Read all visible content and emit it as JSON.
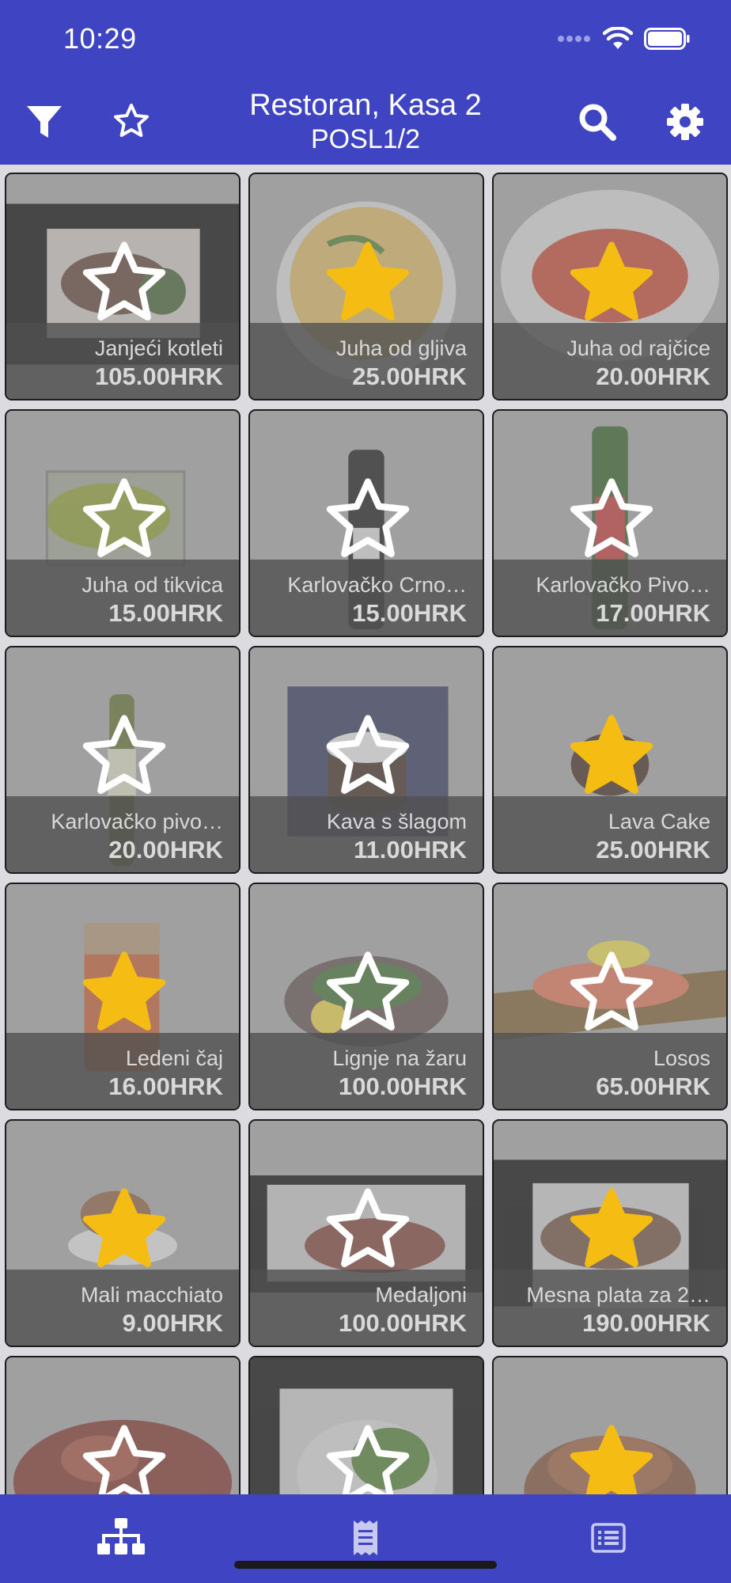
{
  "status_bar": {
    "time": "10:29"
  },
  "header": {
    "title": "Restoran, Kasa 2",
    "subtitle": "POSL1/2"
  },
  "colors": {
    "bar": "#3f44c2",
    "star_filled": "#f5bd14",
    "star_outline": "#ffffff"
  },
  "icons": {
    "filter": "filter-icon",
    "favorites": "star-icon",
    "search": "search-icon",
    "settings": "gear-icon",
    "categories": "hierarchy-icon",
    "receipt": "receipt-icon",
    "list": "list-icon"
  },
  "products": [
    {
      "name": "Janjeći kotleti",
      "price": "105.00HRK",
      "favorite": false
    },
    {
      "name": "Juha od gljiva",
      "price": "25.00HRK",
      "favorite": true
    },
    {
      "name": "Juha od rajčice",
      "price": "20.00HRK",
      "favorite": true
    },
    {
      "name": "Juha od tikvica",
      "price": "15.00HRK",
      "favorite": false
    },
    {
      "name": "Karlovačko Crno…",
      "price": "15.00HRK",
      "favorite": false
    },
    {
      "name": "Karlovačko Pivo…",
      "price": "17.00HRK",
      "favorite": false
    },
    {
      "name": "Karlovačko pivo…",
      "price": "20.00HRK",
      "favorite": false
    },
    {
      "name": "Kava s šlagom",
      "price": "11.00HRK",
      "favorite": false
    },
    {
      "name": "Lava Cake",
      "price": "25.00HRK",
      "favorite": true
    },
    {
      "name": "Ledeni čaj",
      "price": "16.00HRK",
      "favorite": true
    },
    {
      "name": "Lignje na žaru",
      "price": "100.00HRK",
      "favorite": false
    },
    {
      "name": "Losos",
      "price": "65.00HRK",
      "favorite": false
    },
    {
      "name": "Mali macchiato",
      "price": "9.00HRK",
      "favorite": true
    },
    {
      "name": "Medaljoni",
      "price": "100.00HRK",
      "favorite": false
    },
    {
      "name": "Mesna plata za 2…",
      "price": "190.00HRK",
      "favorite": true
    },
    {
      "name": "",
      "price": "",
      "favorite": false
    },
    {
      "name": "",
      "price": "",
      "favorite": false
    },
    {
      "name": "",
      "price": "",
      "favorite": true
    }
  ]
}
